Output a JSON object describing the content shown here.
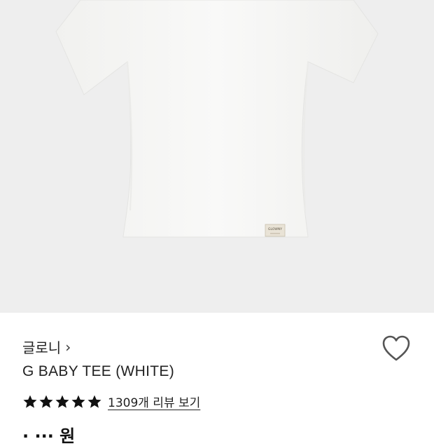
{
  "product": {
    "image_alt": "G BABY TEE white t-shirt",
    "label_text": "GLOWNY",
    "brand": "글로니",
    "brand_chevron": "›",
    "name": "G BABY TEE (WHITE)",
    "rating_stars": 5,
    "review_link": "1309개 리뷰 보기",
    "price_partial": "· ··· 원"
  },
  "colors": {
    "image_background": "#eeeeee",
    "star": "#111111",
    "text": "#222222"
  },
  "icons": {
    "heart": "heart-outline-icon",
    "star": "star-filled-icon",
    "chevron": "chevron-right-icon"
  }
}
